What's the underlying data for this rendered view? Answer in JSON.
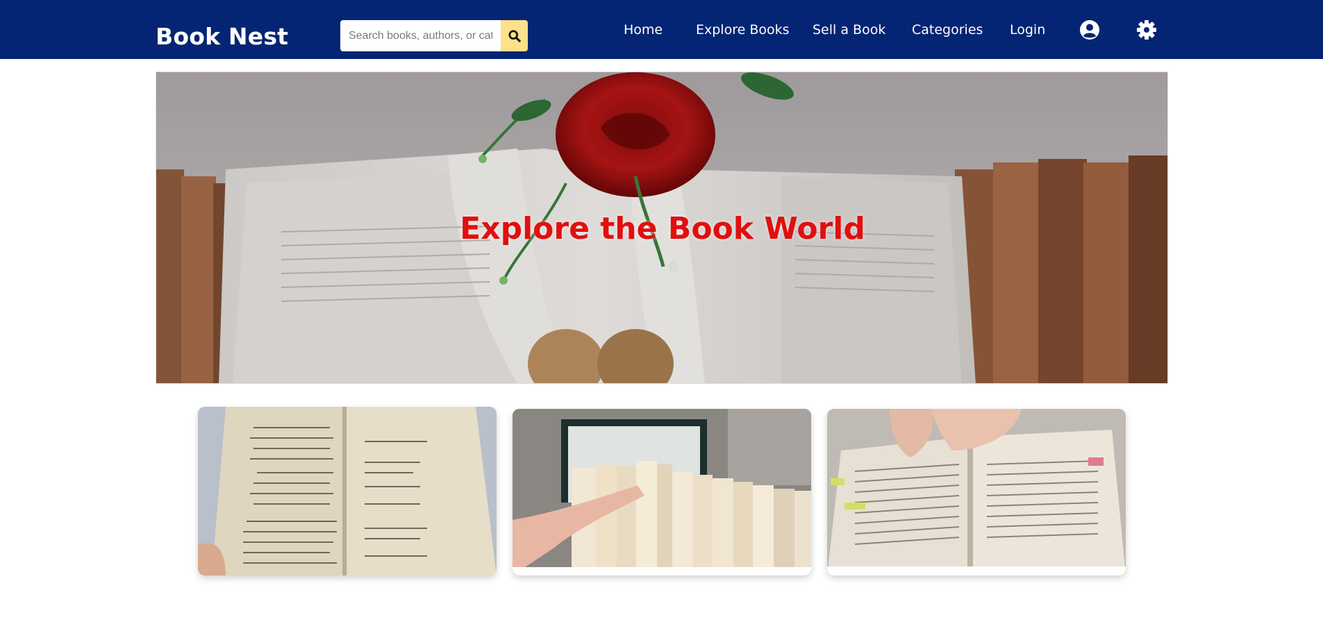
{
  "brand": {
    "name": "Book Nest"
  },
  "search": {
    "placeholder": "Search books, authors, or categories",
    "icon": "search-icon"
  },
  "nav": {
    "items": [
      {
        "label": "Home"
      },
      {
        "label": "Explore Books"
      },
      {
        "label": "Sell a Book"
      },
      {
        "label": "Categories"
      },
      {
        "label": "Login"
      }
    ],
    "profile_icon": "user-circle-icon",
    "settings_icon": "gear-icon"
  },
  "hero": {
    "title": "Explore the Book World",
    "image": "open book with red rose"
  },
  "cards": [
    {
      "image": "hands holding open poetry book"
    },
    {
      "image": "finger pointing at books on shelf"
    },
    {
      "image": "hands reading open book with bookmarks"
    }
  ],
  "colors": {
    "navbar": "#042573",
    "search_button": "#fbe18a",
    "hero_title": "#e10f0f",
    "nav_text": "#ffffff"
  }
}
